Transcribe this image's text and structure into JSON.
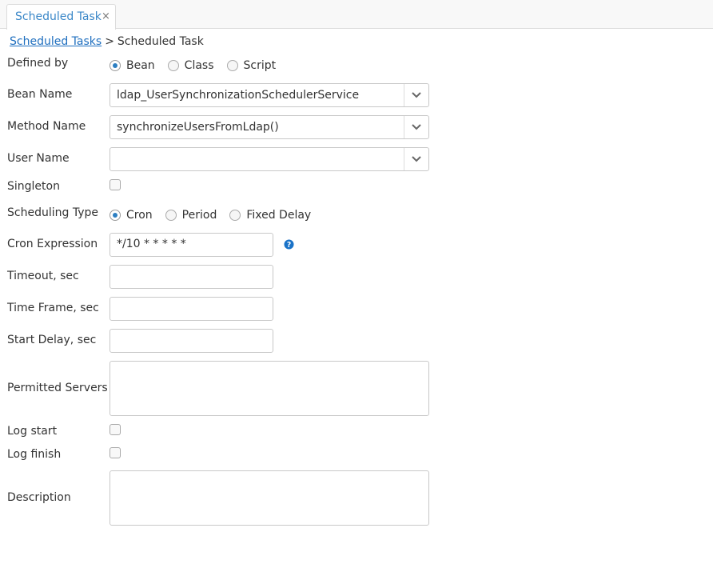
{
  "tabs": [
    {
      "label": "Scheduled Task",
      "close": "×"
    }
  ],
  "breadcrumb": {
    "link": "Scheduled Tasks",
    "separator": ">",
    "current": "Scheduled Task"
  },
  "form": {
    "defined_by": {
      "label": "Defined by",
      "options": [
        "Bean",
        "Class",
        "Script"
      ],
      "selected": "Bean"
    },
    "bean_name": {
      "label": "Bean Name",
      "value": "ldap_UserSynchronizationSchedulerService"
    },
    "method_name": {
      "label": "Method Name",
      "value": "synchronizeUsersFromLdap()"
    },
    "user_name": {
      "label": "User Name",
      "value": ""
    },
    "singleton": {
      "label": "Singleton",
      "checked": false
    },
    "scheduling_type": {
      "label": "Scheduling Type",
      "options": [
        "Cron",
        "Period",
        "Fixed Delay"
      ],
      "selected": "Cron"
    },
    "cron_expression": {
      "label": "Cron Expression",
      "value": "*/10 * * * * *"
    },
    "timeout": {
      "label": "Timeout, sec",
      "value": ""
    },
    "time_frame": {
      "label": "Time Frame, sec",
      "value": ""
    },
    "start_delay": {
      "label": "Start Delay, sec",
      "value": ""
    },
    "permitted_servers": {
      "label": "Permitted Servers",
      "value": ""
    },
    "log_start": {
      "label": "Log start",
      "checked": false
    },
    "log_finish": {
      "label": "Log finish",
      "checked": false
    },
    "description": {
      "label": "Description",
      "value": ""
    }
  },
  "icons": {
    "tab_close": "close-icon",
    "dropdown": "chevron-down-icon",
    "help": "help-icon"
  },
  "colors": {
    "accent": "#2d7fc2",
    "link": "#1f6fbf",
    "help_icon": "#1a73c8",
    "border": "#c8c8c8"
  }
}
